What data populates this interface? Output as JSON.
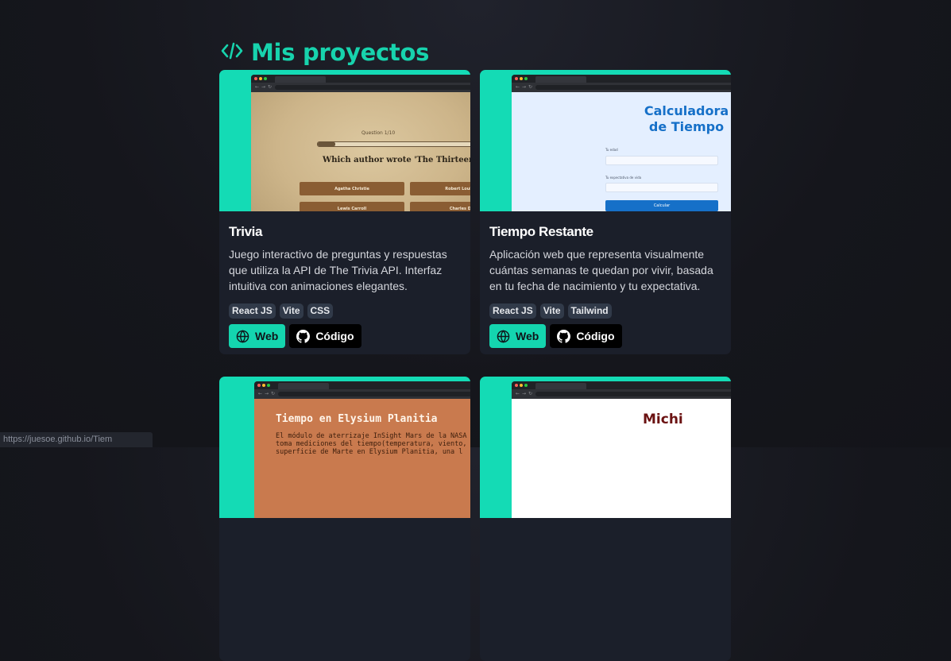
{
  "section": {
    "title": "Mis proyectos",
    "title_icon": "code-icon",
    "accent": "#17d3ad"
  },
  "projects": [
    {
      "title": "Trivia",
      "description": "Juego interactivo de preguntas y respuestas que utiliza la API de The Trivia API. Interfaz intuitiva con animaciones elegantes.",
      "tags": [
        "React JS",
        "Vite",
        "CSS"
      ],
      "web_label": "Web",
      "code_label": "Código",
      "preview": {
        "counter": "Question 1/10",
        "question": "Which author wrote 'The Thirteen Probl",
        "answers": [
          "Agatha Christie",
          "Robert Louis St",
          "Lewis Carroll",
          "Charles Did"
        ],
        "progress": 0.1
      }
    },
    {
      "title": "Tiempo Restante",
      "description": "Aplicación web que representa visualmente cuántas semanas te quedan por vivir, basada en tu fecha de nacimiento y tu expectativa.",
      "tags": [
        "React JS",
        "Vite",
        "Tailwind"
      ],
      "web_label": "Web",
      "code_label": "Código",
      "preview": {
        "heading": "Calculadora\nde Tiempo",
        "age_label": "Tu edad",
        "expectancy_label": "Tu expectativa de vida",
        "button": "Calcular"
      }
    },
    {
      "preview": {
        "heading": "Tiempo en Elysium Planitia",
        "body": "El módulo de aterrizaje InSight Mars de la NASA\ntoma mediciones del tiempo(temperatura, viento,\nsuperficie de Marte en Elysium Planitia, una l"
      }
    },
    {
      "preview": {
        "heading": "Michi"
      }
    }
  ],
  "status_bar": {
    "url": "https://juesoe.github.io/Tiem"
  }
}
